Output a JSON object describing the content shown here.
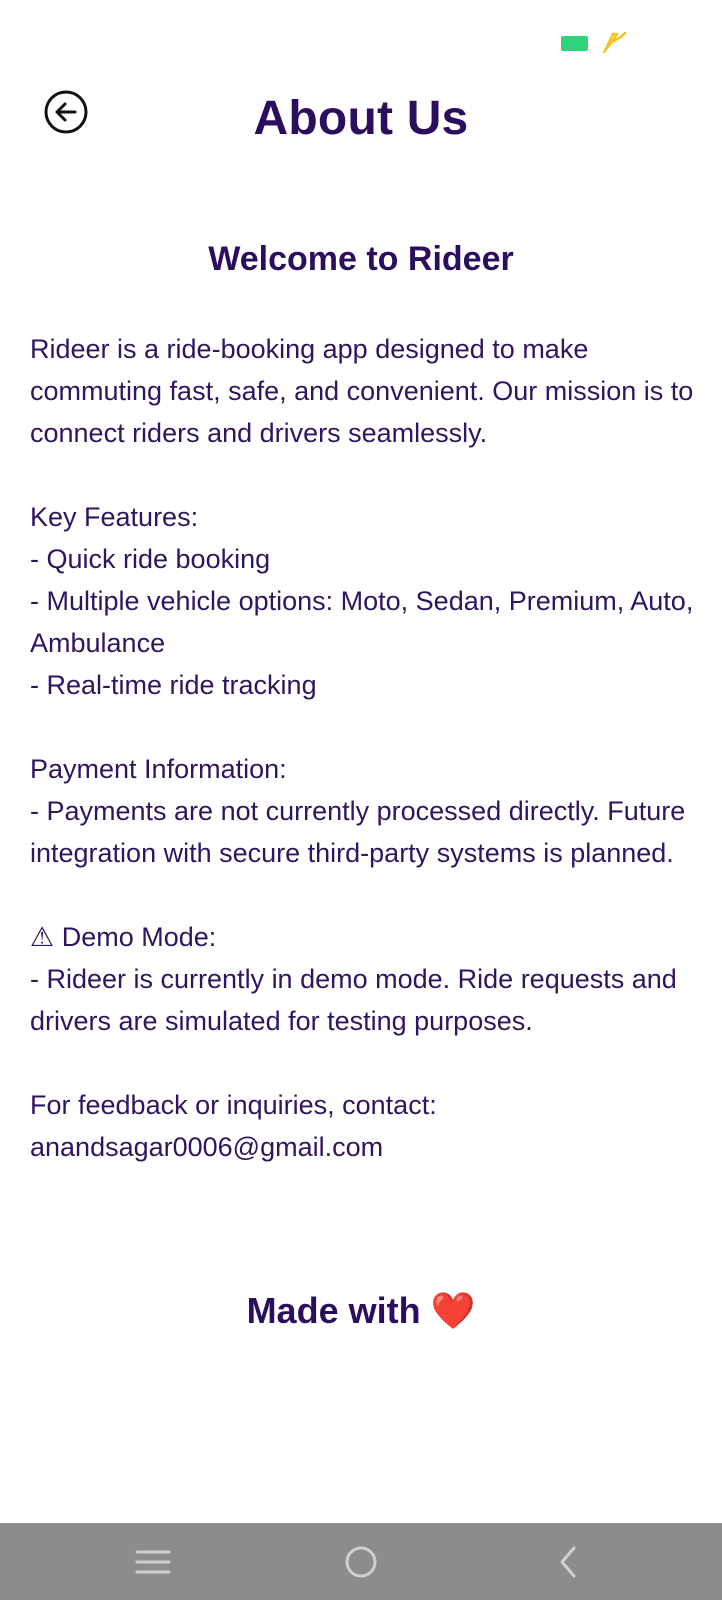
{
  "status_bar": {
    "battery_color": "#2ed47a",
    "charging_icon": "lightning-bolt-icon"
  },
  "header": {
    "back_icon": "arrow-left-circle-icon",
    "title": "About Us"
  },
  "main": {
    "heading": "Welcome to Rideer",
    "paragraphs": [
      "Rideer is a ride-booking app designed to make commuting fast, safe, and convenient. Our mission is to connect riders and drivers seamlessly.",
      "Key Features:\n- Quick ride booking\n- Multiple vehicle options: Moto, Sedan, Premium, Auto, Ambulance\n- Real-time ride tracking",
      "Payment Information:\n- Payments are not currently processed directly. Future integration with secure third-party systems is planned.",
      "⚠ Demo Mode:\n- Rideer is currently in demo mode. Ride requests and drivers are simulated for testing purposes.",
      "For feedback or inquiries, contact:\nanandsagar0006@gmail.com"
    ],
    "footer_text": "Made with",
    "footer_icon": "heart-icon",
    "footer_emoji": "❤️"
  },
  "nav_bar": {
    "background": "#8c8c8e",
    "icons": [
      "menu-icon",
      "home-circle-icon",
      "back-chevron-icon"
    ]
  }
}
